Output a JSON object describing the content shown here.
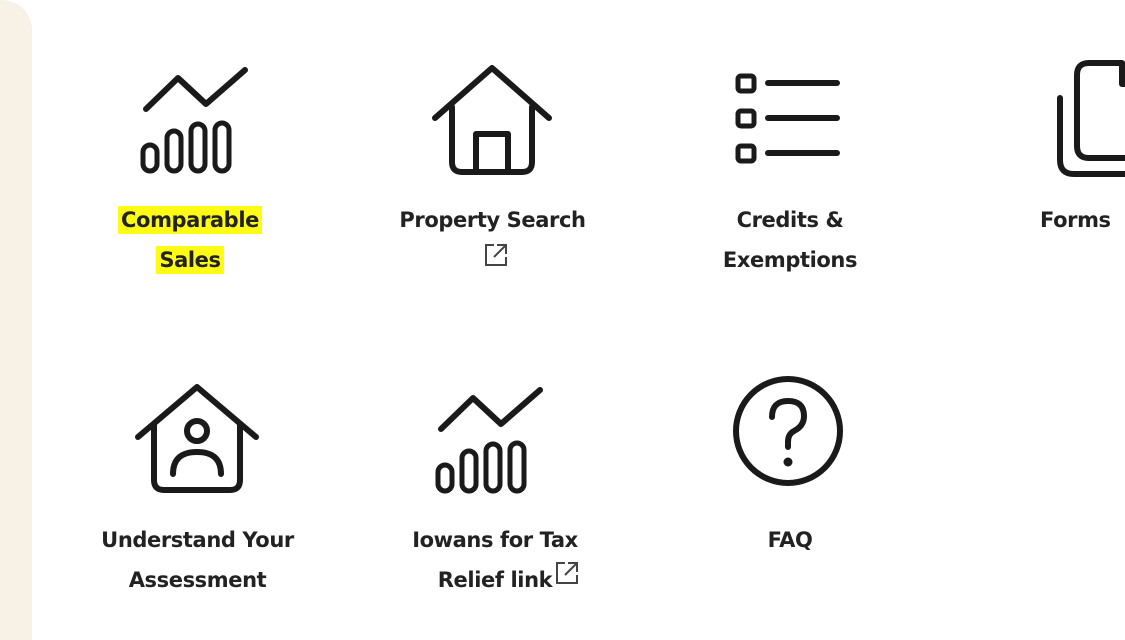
{
  "tiles": [
    {
      "key": "comparable_sales",
      "line1": "Comparable",
      "line2": "Sales",
      "icon": "bar-chart-trend-icon",
      "highlight_color": "#fffb17"
    },
    {
      "key": "property_search",
      "line1": "Property Search",
      "icon": "house-icon",
      "external": true
    },
    {
      "key": "credits_exemptions",
      "line1": "Credits &",
      "line2": "Exemptions",
      "icon": "list-icon"
    },
    {
      "key": "forms",
      "line1": "Forms",
      "icon": "documents-icon"
    },
    {
      "key": "understand_assessment",
      "line1": "Understand Your",
      "line2": "Assessment",
      "icon": "house-person-icon"
    },
    {
      "key": "iowans_tax_relief",
      "line1": "Iowans for Tax",
      "line2": "Relief link",
      "icon": "bar-chart-trend-icon",
      "external": true
    },
    {
      "key": "faq",
      "line1": "FAQ",
      "icon": "question-circle-icon"
    }
  ],
  "icons": {
    "external": "external-link-icon"
  },
  "colors": {
    "panel": "#f7f1e6",
    "highlight": "#fffb17",
    "text": "#222222"
  }
}
